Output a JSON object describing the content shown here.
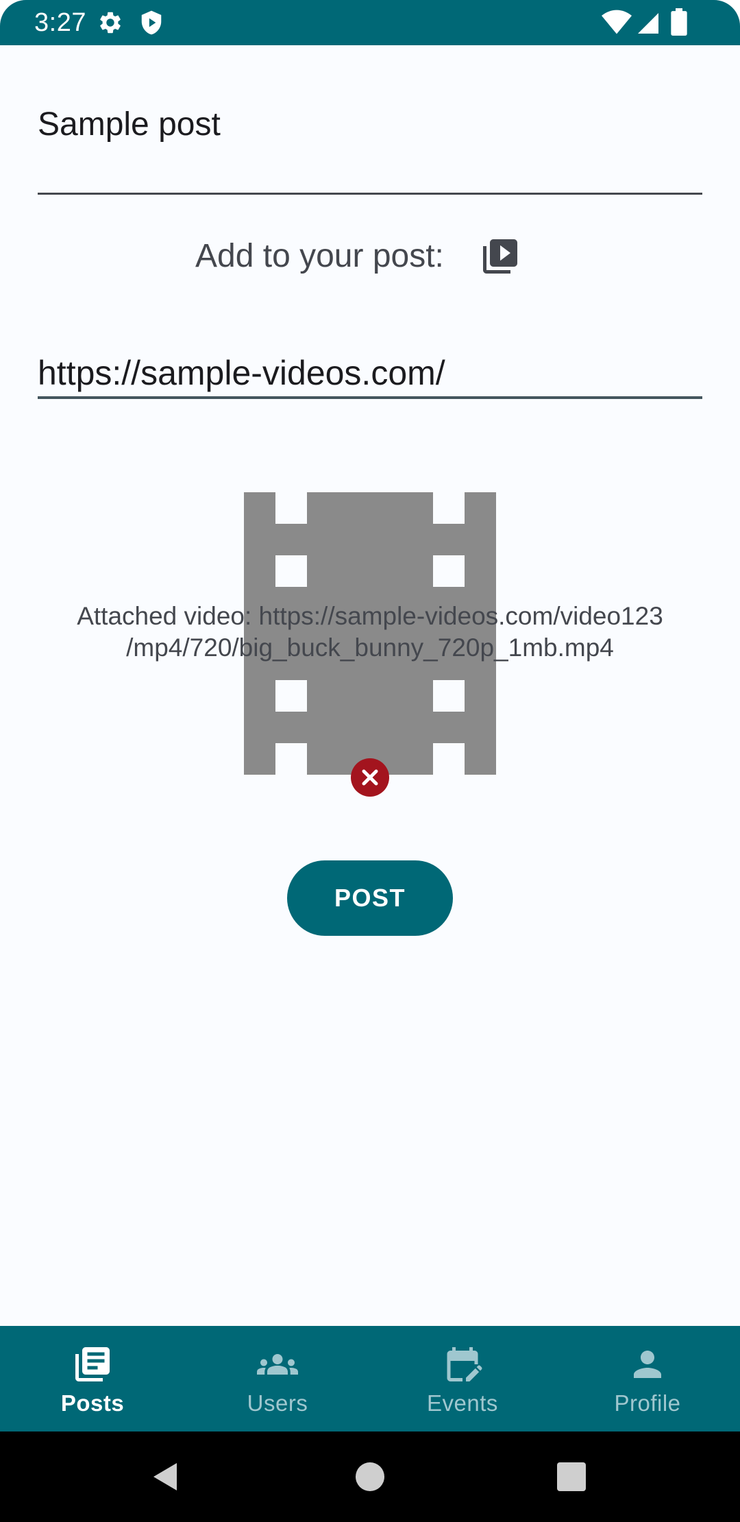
{
  "status_bar": {
    "time": "3:27",
    "icons": [
      "settings-icon",
      "shield-icon",
      "wifi-icon",
      "signal-icon",
      "battery-icon"
    ]
  },
  "post_form": {
    "title_value": "Sample post",
    "add_label": "Add to your post:",
    "add_icon": "video-library-icon",
    "url_value": "https://sample-videos.com/",
    "attached_video_text": "Attached video: https://sample-videos.com/video123\n/mp4/720/big_buck_bunny_720p_1mb.mp4",
    "remove_icon": "close-icon",
    "post_button_label": "POST"
  },
  "bottom_nav": {
    "items": [
      {
        "label": "Posts",
        "icon": "article-icon",
        "active": true
      },
      {
        "label": "Users",
        "icon": "group-icon",
        "active": false
      },
      {
        "label": "Events",
        "icon": "calendar-edit-icon",
        "active": false
      },
      {
        "label": "Profile",
        "icon": "person-icon",
        "active": false
      }
    ]
  },
  "system_nav": {
    "icons": [
      "back-icon",
      "home-icon",
      "recents-icon"
    ]
  },
  "colors": {
    "primary": "#006876",
    "background": "#fafcff",
    "error": "#a3141e",
    "nav_inactive": "#9fc7cf",
    "film_placeholder": "#8a8a8a"
  }
}
